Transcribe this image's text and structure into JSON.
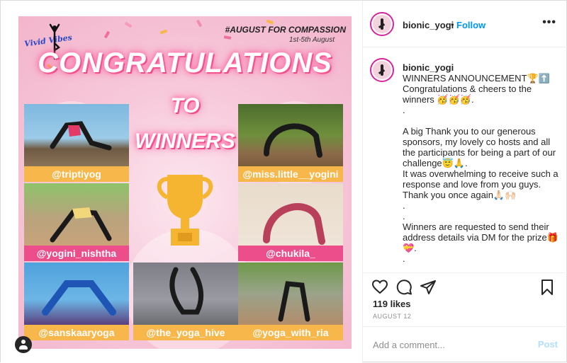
{
  "poster": {
    "logo_text": "Vivid Vibes",
    "hashtag": "#AUGUST FOR COMPASSION",
    "dates": "1st-5th August",
    "headline": "CONGRATULATIONS",
    "to": "TO",
    "winners": "WINNERS",
    "winner_tags": [
      "@triptiyog",
      "@miss.little__yogini",
      "@yogini_nishtha",
      "@chukila_",
      "@sanskaaryoga",
      "@the_yoga_hive",
      "@yoga_with_ria"
    ]
  },
  "header": {
    "username": "bionic_yogi",
    "separator": "•",
    "follow_label": "Follow",
    "more_icon": "ellipsis-icon"
  },
  "caption": {
    "username": "bionic_yogi",
    "lines": [
      "WINNERS ANNOUNCEMENT🏆⬆️",
      "Congratulations & cheers to the winners 🥳🥳🥳.",
      ".",
      "",
      "A big Thank you to our generous sponsors, my lovely co hosts and all the participants for being a part of our challenge😇🙏.",
      "It was overwhelming to receive such a response and love from you guys. Thank you once again🙏🏻🙌🏻",
      ".",
      ".",
      "Winners are requested to send their address details via DM for the prize🎁💝.",
      "."
    ]
  },
  "actions": {
    "likes": "119 likes",
    "date": "AUGUST 12"
  },
  "comment": {
    "placeholder": "Add a comment...",
    "post_label": "Post"
  },
  "colors": {
    "follow": "#0095f6",
    "post_disabled": "#b2dffc",
    "tag_orange": "#f7b74a",
    "tag_pink": "#ec4d8b",
    "headline_glow": "#ff4f96"
  }
}
